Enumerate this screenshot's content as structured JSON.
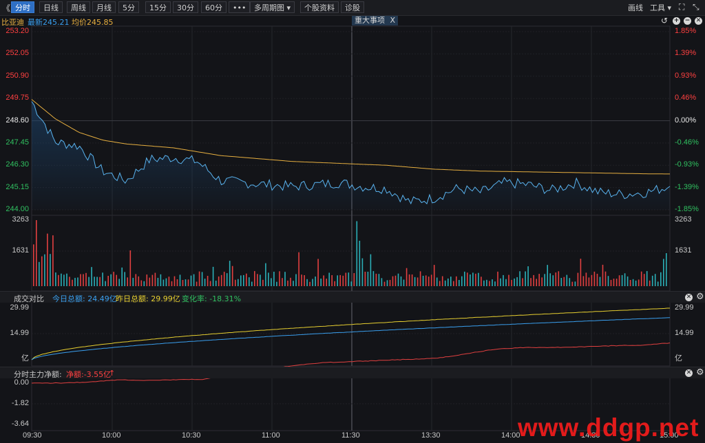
{
  "toolbar": {
    "back_glyph": "《",
    "tabs": [
      "分时",
      "日线",
      "周线",
      "月线",
      "5分",
      "15分",
      "30分",
      "60分",
      "•••",
      "多周期图 ▾",
      "个股资料",
      "诊股"
    ],
    "right": {
      "draw": "画线",
      "tools": "工具 ▾",
      "expand": "⛶",
      "shrink": "⤡"
    }
  },
  "info": {
    "stock_name": "比亚迪",
    "latest": "最新245.21",
    "average": "均价245.85",
    "event_label": "重大事项",
    "event_close": "X",
    "colors": {
      "latest": "#3aa0f0",
      "average": "#e8b040",
      "name": "#e8b040"
    }
  },
  "price_axis": {
    "left": [
      "253.20",
      "252.05",
      "250.90",
      "249.75",
      "248.60",
      "247.45",
      "246.30",
      "245.15",
      "244.00"
    ],
    "right": [
      "1.85%",
      "1.39%",
      "0.93%",
      "0.46%",
      "0.00%",
      "-0.46%",
      "-0.93%",
      "-1.39%",
      "-1.85%"
    ]
  },
  "volume_axis": {
    "left": [
      "3263",
      "1631"
    ],
    "right": [
      "3263",
      "1631"
    ]
  },
  "amount_panel": {
    "title": "成交对比",
    "today": "今日总额: 24.49亿",
    "yesterday": "昨日总额: 29.99亿",
    "change": "变化率: -18.31%",
    "axis": [
      "29.99",
      "14.99",
      "亿"
    ]
  },
  "flow_panel": {
    "title": "分时主力净额:",
    "net": "净额:-3.55亿",
    "arrow": "↑",
    "axis": [
      "0.00",
      "-1.82",
      "-3.64"
    ]
  },
  "time_axis": [
    "09:30",
    "10:00",
    "10:30",
    "11:00",
    "11:30",
    "13:30",
    "14:00",
    "14:30",
    "15:00"
  ],
  "watermark": "www.ddgp.net",
  "chart_data": {
    "type": "line",
    "x": [
      "09:30",
      "09:35",
      "09:40",
      "09:45",
      "09:50",
      "09:55",
      "10:00",
      "10:10",
      "10:20",
      "10:30",
      "10:40",
      "10:50",
      "11:00",
      "11:10",
      "11:20",
      "11:30",
      "13:10",
      "13:20",
      "13:30",
      "13:40",
      "13:50",
      "14:00",
      "14:10",
      "14:20",
      "14:30",
      "14:40",
      "14:50",
      "15:00"
    ],
    "series": [
      {
        "name": "最新",
        "values": [
          249.6,
          247.5,
          247.3,
          246.0,
          245.5,
          246.6,
          246.7,
          246.5,
          245.5,
          245.4,
          245.3,
          245.2,
          245.3,
          245.4,
          245.2,
          245.1,
          244.4,
          244.6,
          245.1,
          244.9,
          245.4,
          245.3,
          245.0,
          245.4,
          244.9,
          244.8,
          244.9,
          245.21
        ]
      },
      {
        "name": "均价",
        "values": [
          249.7,
          248.7,
          248.0,
          247.6,
          247.4,
          247.3,
          247.2,
          247.0,
          246.8,
          246.7,
          246.6,
          246.5,
          246.45,
          246.4,
          246.35,
          246.3,
          246.2,
          246.1,
          246.05,
          246.0,
          245.98,
          245.96,
          245.94,
          245.92,
          245.9,
          245.88,
          245.86,
          245.85
        ]
      }
    ],
    "ylim": [
      244.0,
      253.2
    ]
  }
}
